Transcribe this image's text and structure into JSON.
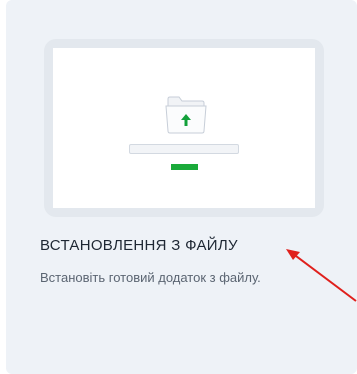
{
  "card": {
    "title": "ВСТАНОВЛЕННЯ З ФАЙЛУ",
    "description": "Встановіть готовий додаток з файлу.",
    "illustration": {
      "icon": "folder-upload-icon",
      "accent_color": "#1aaa3a",
      "arrow_color": "#12a03a"
    }
  },
  "annotation": {
    "icon": "red-arrow-icon",
    "color": "#e0201c"
  }
}
